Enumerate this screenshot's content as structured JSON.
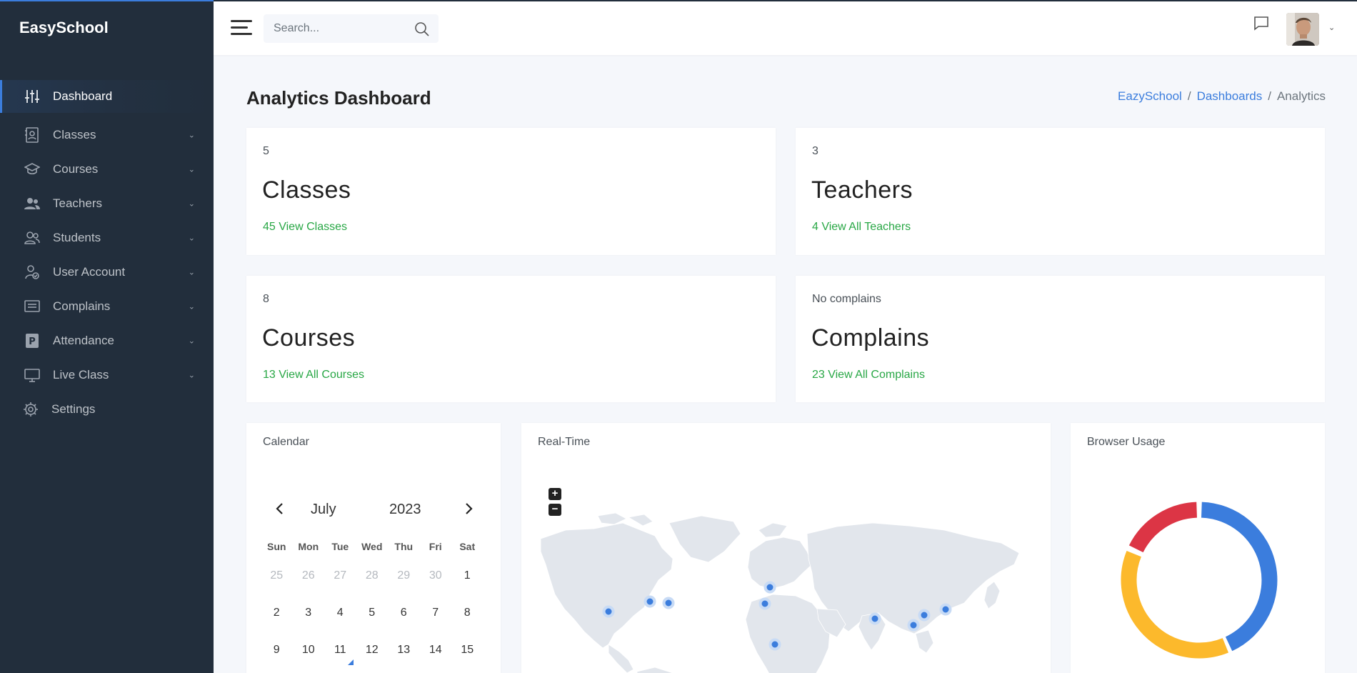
{
  "app": {
    "brand": "EasySchool"
  },
  "sidebar": {
    "items": [
      {
        "label": "Dashboard",
        "icon": "sliders-icon"
      },
      {
        "label": "Classes",
        "icon": "contacts-book-icon"
      },
      {
        "label": "Courses",
        "icon": "graduation-cap-icon"
      },
      {
        "label": "Teachers",
        "icon": "users-icon"
      },
      {
        "label": "Students",
        "icon": "people-icon"
      },
      {
        "label": "User Account",
        "icon": "user-check-icon"
      },
      {
        "label": "Complains",
        "icon": "message-box-icon"
      },
      {
        "label": "Attendance",
        "icon": "parking-p-icon"
      },
      {
        "label": "Live Class",
        "icon": "monitor-icon"
      },
      {
        "label": "Settings",
        "icon": "gear-icon"
      }
    ]
  },
  "header": {
    "search_placeholder": "Search..."
  },
  "page": {
    "title_bold": "Analytics",
    "title_rest": " Dashboard",
    "breadcrumb": [
      "EazySchool",
      "Dashboards",
      "Analytics"
    ]
  },
  "stats": {
    "classes": {
      "count": "5",
      "name": "Classes",
      "link": "45 View Classes"
    },
    "teachers": {
      "count": "3",
      "name": "Teachers",
      "link": "4 View All Teachers"
    },
    "courses": {
      "count": "8",
      "name": "Courses",
      "link": "13 View All Courses"
    },
    "complains": {
      "count": "No complains",
      "name": "Complains",
      "link": "23 View All Complains"
    }
  },
  "calendar": {
    "title": "Calendar",
    "month": "July",
    "year": "2023",
    "weekdays": [
      "Sun",
      "Mon",
      "Tue",
      "Wed",
      "Thu",
      "Fri",
      "Sat"
    ],
    "weeks": [
      [
        "25",
        "26",
        "27",
        "28",
        "29",
        "30",
        "1"
      ],
      [
        "2",
        "3",
        "4",
        "5",
        "6",
        "7",
        "8"
      ],
      [
        "9",
        "10",
        "11",
        "12",
        "13",
        "14",
        "15"
      ]
    ]
  },
  "realtime": {
    "title": "Real-Time",
    "zoom_in": "+",
    "zoom_out": "−"
  },
  "browser_usage": {
    "title": "Browser Usage",
    "colors": [
      "#3b7ddd",
      "#fcb92c",
      "#dc3545"
    ]
  },
  "colors": {
    "accent": "#3b7ddd",
    "sidebar_bg": "#222e3c",
    "link_green": "#28a745"
  }
}
